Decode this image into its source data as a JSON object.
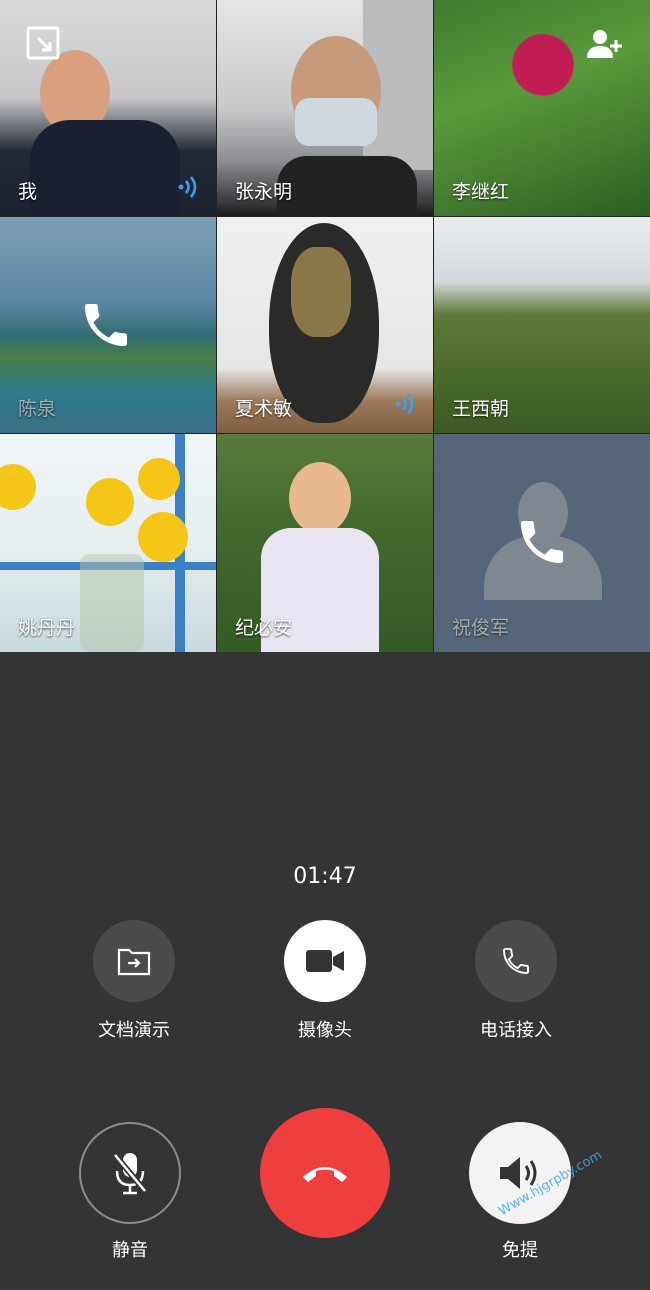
{
  "participants": [
    {
      "name": "我",
      "speaking": true
    },
    {
      "name": "张永明",
      "speaking": false
    },
    {
      "name": "李继红",
      "speaking": false
    },
    {
      "name": "陈泉",
      "speaking": false,
      "calling": true
    },
    {
      "name": "夏术敏",
      "speaking": true
    },
    {
      "name": "王西朝",
      "speaking": false
    },
    {
      "name": "姚丹丹",
      "speaking": false
    },
    {
      "name": "纪必安",
      "speaking": false
    },
    {
      "name": "祝俊军",
      "speaking": false,
      "calling": true
    }
  ],
  "top_icons": {
    "minimize": "minimize-window-icon",
    "add_member": "add-person-icon"
  },
  "call": {
    "duration": "01:47"
  },
  "controls": {
    "share_doc": {
      "label": "文档演示",
      "icon": "document-share-icon"
    },
    "camera": {
      "label": "摄像头",
      "icon": "video-camera-icon"
    },
    "phone_join": {
      "label": "电话接入",
      "icon": "phone-icon"
    },
    "mute": {
      "label": "静音",
      "icon": "mic-off-icon"
    },
    "hangup": {
      "icon": "hang-up-icon"
    },
    "speaker": {
      "label": "免提",
      "icon": "speaker-icon"
    }
  },
  "watermark": "Www.hjgrpby.com",
  "colors": {
    "hangup": "#ef3e3e",
    "speaking": "#3aa0f2",
    "background": "#333436"
  }
}
